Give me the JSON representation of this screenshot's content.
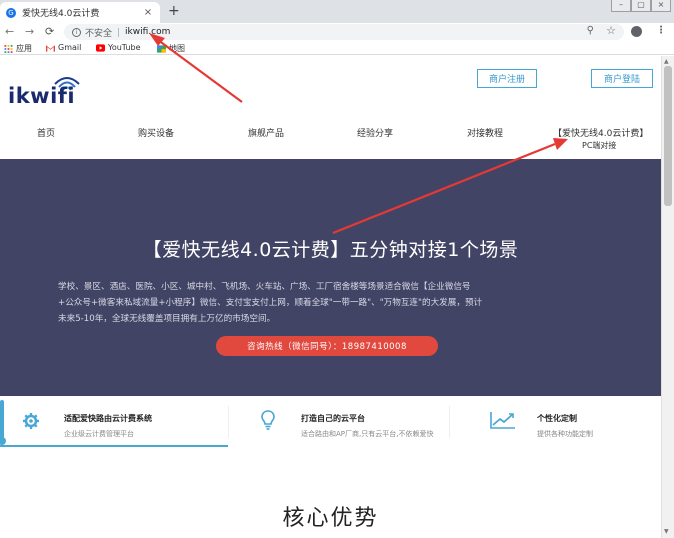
{
  "browser": {
    "tab_title": "爱快无线4.0云计费",
    "tab_close": "×",
    "new_tab": "+",
    "insecure_label": "不安全",
    "url": "ikwifi.com",
    "bookmarks": [
      {
        "label": "应用",
        "icon": "apps-grid-icon"
      },
      {
        "label": "Gmail",
        "icon": "gmail-icon"
      },
      {
        "label": "YouTube",
        "icon": "youtube-icon"
      },
      {
        "label": "地图",
        "icon": "maps-icon"
      }
    ]
  },
  "header": {
    "logo_text": "ikwifi",
    "register_label": "商户注册",
    "login_label": "商户登陆"
  },
  "nav": {
    "items": [
      "首页",
      "购买设备",
      "旗舰产品",
      "经验分享",
      "对接教程",
      "【爱快无线4.0云计费】"
    ],
    "sub_item": "PC端对接"
  },
  "hero": {
    "title": "【爱快无线4.0云计费】五分钟对接1个场景",
    "desc_line1": "学校、景区、酒店、医院、小区、城中村、飞机场、火车站、广场、工厂宿舍楼等场景适合微信【企业微信号",
    "desc_line2": "+公众号+微客来私域流量+小程序】微信、支付宝支付上网，顺着全球\"一带一路\"、\"万物互连\"的大发展，预计",
    "desc_line3": "未来5-10年，全球无线覆盖项目拥有上万亿的市场空间。",
    "hotline": "咨询热线（微信同号）：18987410008"
  },
  "features": [
    {
      "title": "适配爱快路由云计费系统",
      "sub": "企业级云计费管理平台",
      "icon": "gear-icon"
    },
    {
      "title": "打造自己的云平台",
      "sub": "适合路由和AP厂商,只有云平台,不依赖爱快",
      "icon": "lightbulb-icon"
    },
    {
      "title": "个性化定制",
      "sub": "提供各种功能定制",
      "icon": "chart-trend-icon"
    }
  ],
  "section": {
    "title": "核心优势"
  },
  "colors": {
    "hero_bg": "#424465",
    "accent_blue": "#43a7d8",
    "hotline_red": "#e1493f",
    "arrow_red": "#e53935"
  }
}
